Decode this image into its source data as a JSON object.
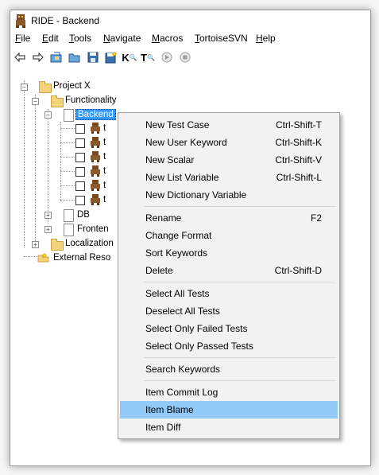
{
  "window": {
    "title": "RIDE - Backend"
  },
  "menubar": [
    "File",
    "Edit",
    "Tools",
    "Navigate",
    "Macros",
    "TortoiseSVN",
    "Help"
  ],
  "toolbar": {
    "icons": [
      "arrow-left-icon",
      "arrow-right-icon",
      "open-project-icon",
      "open-folder-icon",
      "save-icon",
      "save-all-icon",
      "keyword-search-icon",
      "test-search-icon",
      "run-icon",
      "stop-icon"
    ],
    "k_label": "K",
    "t_label": "T"
  },
  "tree": {
    "project": "Project X",
    "functionality": "Functionality",
    "backend": "Backend",
    "db": "DB",
    "frontend": "Fronten",
    "localization": "Localization",
    "external": "External Reso",
    "test_prefix": "t"
  },
  "context_menu": {
    "items": [
      {
        "label": "New Test Case",
        "shortcut": "Ctrl-Shift-T"
      },
      {
        "label": "New User Keyword",
        "shortcut": "Ctrl-Shift-K"
      },
      {
        "label": "New Scalar",
        "shortcut": "Ctrl-Shift-V"
      },
      {
        "label": "New List Variable",
        "shortcut": "Ctrl-Shift-L"
      },
      {
        "label": "New Dictionary Variable",
        "shortcut": ""
      },
      {
        "label": "Rename",
        "shortcut": "F2"
      },
      {
        "label": "Change Format",
        "shortcut": ""
      },
      {
        "label": "Sort Keywords",
        "shortcut": ""
      },
      {
        "label": "Delete",
        "shortcut": "Ctrl-Shift-D"
      },
      {
        "label": "Select All Tests",
        "shortcut": ""
      },
      {
        "label": "Deselect All Tests",
        "shortcut": ""
      },
      {
        "label": "Select Only Failed Tests",
        "shortcut": ""
      },
      {
        "label": "Select Only Passed Tests",
        "shortcut": ""
      },
      {
        "label": "Search Keywords",
        "shortcut": ""
      },
      {
        "label": "Item Commit Log",
        "shortcut": ""
      },
      {
        "label": "Item Blame",
        "shortcut": ""
      },
      {
        "label": "Item Diff",
        "shortcut": ""
      }
    ],
    "highlighted": "Item Blame",
    "highlight_color": "#91c9f7"
  },
  "colors": {
    "selection": "#3399ff",
    "folder": "#f5d37a"
  }
}
